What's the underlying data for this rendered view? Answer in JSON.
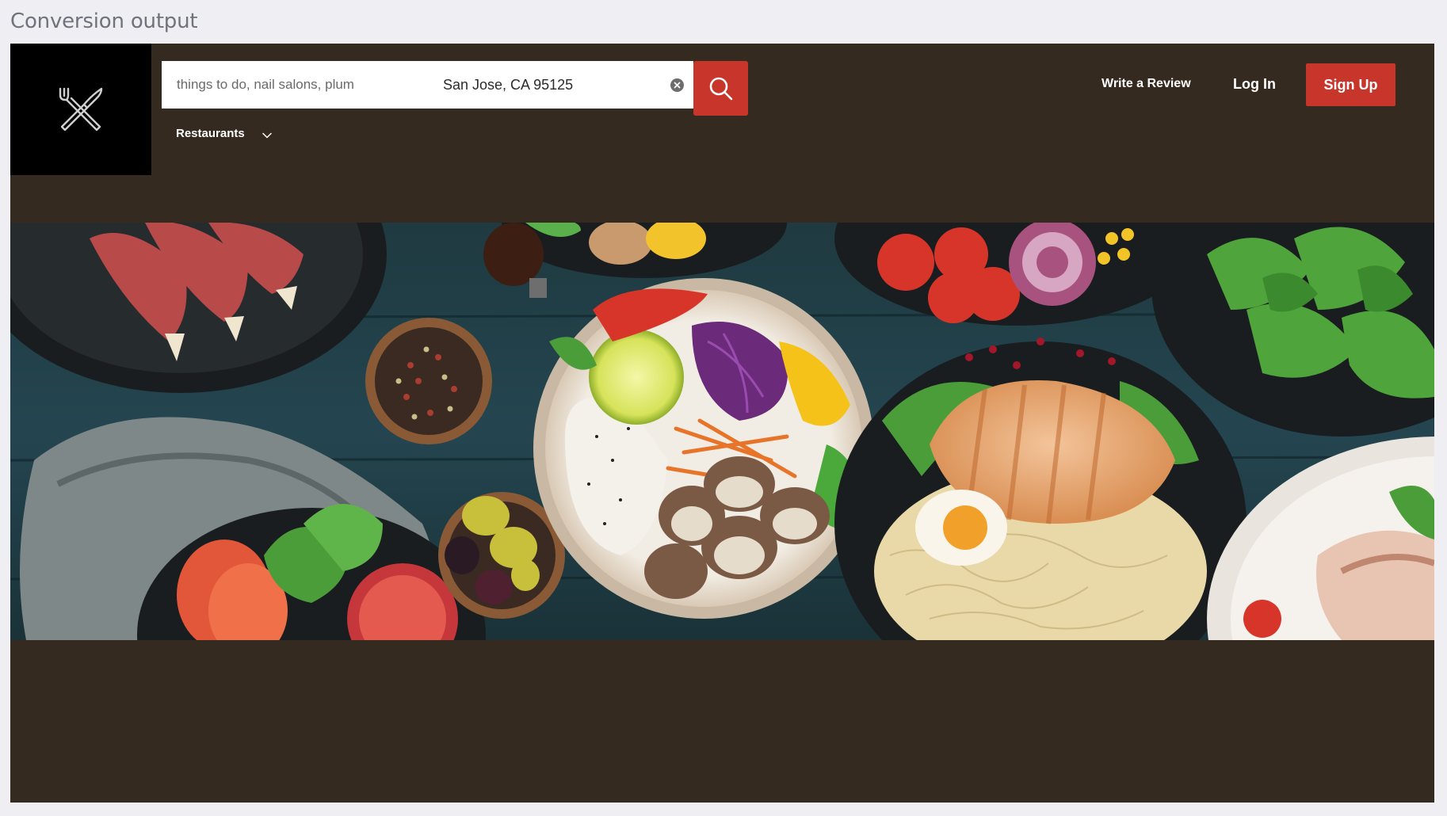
{
  "page": {
    "heading": "Conversion output"
  },
  "header": {
    "search": {
      "find_placeholder": "things to do, nail salons, plum",
      "near_value": "San Jose, CA 95125"
    },
    "category": {
      "label": "Restaurants"
    },
    "nav": {
      "write_review": "Write a Review",
      "log_in": "Log In",
      "sign_up": "Sign Up"
    }
  },
  "icons": {
    "logo": "crossed-fork-knife-icon",
    "search": "magnifier-icon",
    "clear": "close-circle-icon",
    "chevron": "chevron-down-icon"
  },
  "colors": {
    "header_bg": "#352a1f",
    "accent": "#c8352a",
    "logo_bg": "#000000",
    "page_bg": "#eeeef3"
  }
}
